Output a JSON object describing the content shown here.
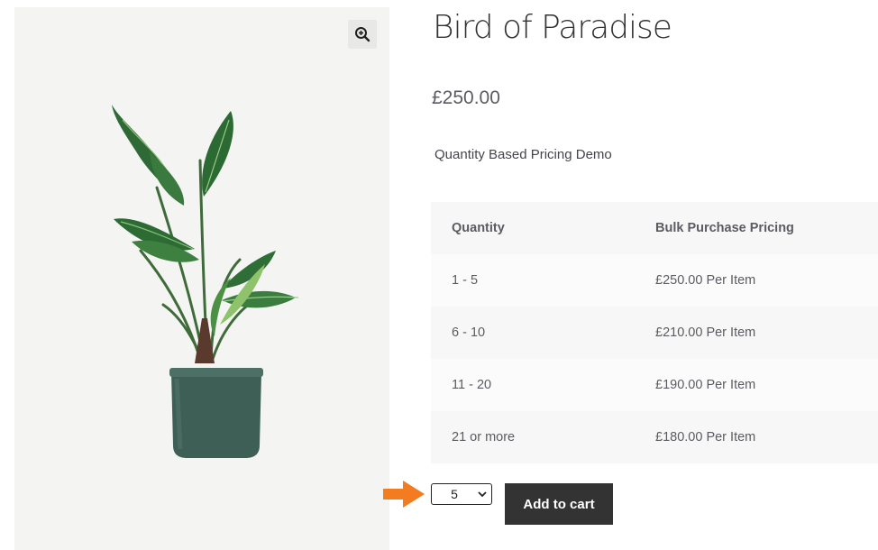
{
  "product": {
    "title": "Bird of Paradise",
    "price": "£250.00",
    "description": "Quantity Based Pricing Demo"
  },
  "gallery": {
    "zoom_icon": "zoom-in-icon",
    "image_subject": "bird-of-paradise plant in green pot"
  },
  "pricing_table": {
    "headers": [
      "Quantity",
      "Bulk Purchase Pricing"
    ],
    "rows": [
      [
        "1 - 5",
        "£250.00 Per Item"
      ],
      [
        "6 - 10",
        "£210.00 Per Item"
      ],
      [
        "11 - 20",
        "£190.00 Per Item"
      ],
      [
        "21 or more",
        "£180.00 Per Item"
      ]
    ]
  },
  "cart": {
    "quantity_selected": "5",
    "add_to_cart_label": "Add to cart"
  },
  "colors": {
    "button": "#333333",
    "arrow": "#f47c20",
    "gallery_bg": "#f4f5f3"
  }
}
